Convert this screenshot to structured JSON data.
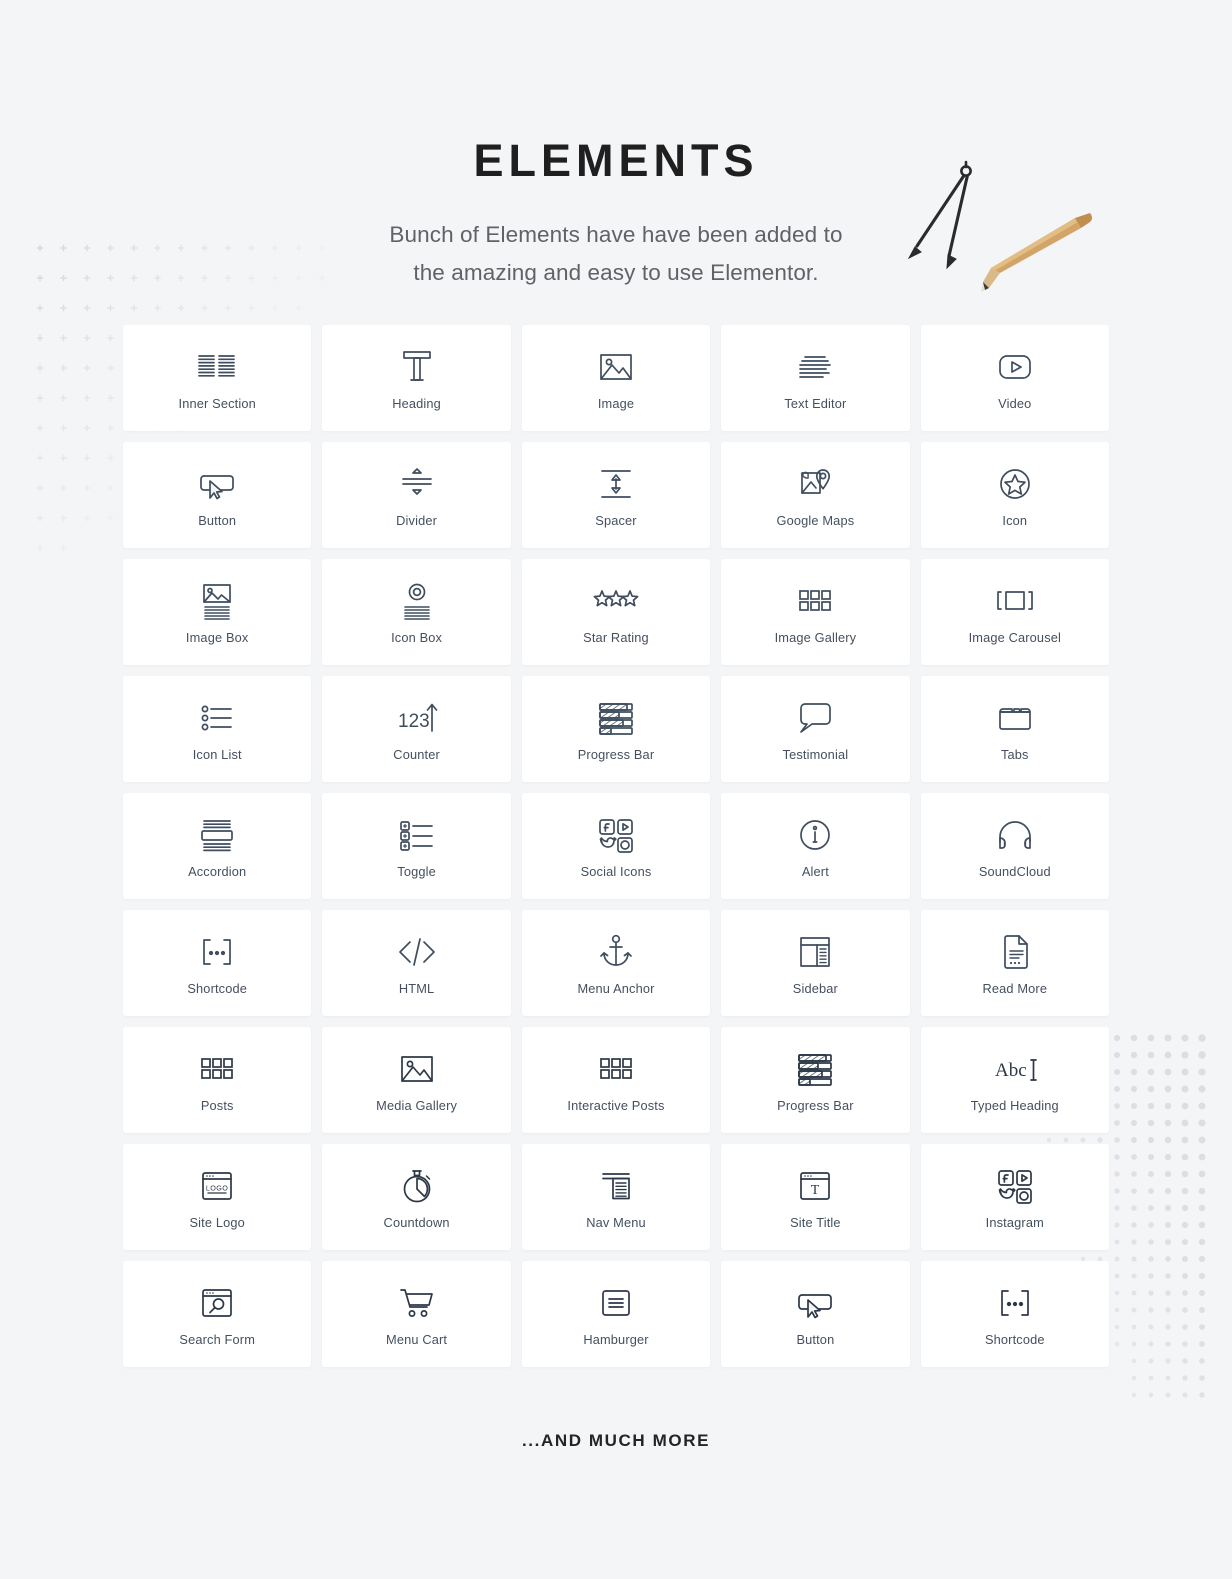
{
  "header": {
    "title": "ELEMENTS",
    "subtitle_line1": "Bunch of Elements have have been added to",
    "subtitle_line2": "the amazing and easy to use  Elementor."
  },
  "footer": {
    "text": "...AND MUCH MORE"
  },
  "colors": {
    "page_background": "#f4f5f7",
    "card_background": "#ffffff",
    "icon_stroke": "#3f4d5e",
    "label_text": "#44505f",
    "title_text": "#1f1f1f",
    "subtitle_text": "#5f6368",
    "decoration": "#d8d9dc",
    "pencil_wood": "#d8b07a",
    "pencil_body": "#c79a5e"
  },
  "grid": {
    "columns": 5,
    "cards": [
      {
        "label": "Inner Section",
        "icon": "inner-section-icon"
      },
      {
        "label": "Heading",
        "icon": "heading-t-icon"
      },
      {
        "label": "Image",
        "icon": "image-icon"
      },
      {
        "label": "Text Editor",
        "icon": "text-editor-icon"
      },
      {
        "label": "Video",
        "icon": "video-play-icon"
      },
      {
        "label": "Button",
        "icon": "button-cursor-icon"
      },
      {
        "label": "Divider",
        "icon": "divider-icon"
      },
      {
        "label": "Spacer",
        "icon": "spacer-icon"
      },
      {
        "label": "Google Maps",
        "icon": "google-maps-pin-icon"
      },
      {
        "label": "Icon",
        "icon": "star-circle-icon"
      },
      {
        "label": "Image Box",
        "icon": "image-box-icon"
      },
      {
        "label": "Icon Box",
        "icon": "icon-box-icon"
      },
      {
        "label": "Star Rating",
        "icon": "star-rating-icon"
      },
      {
        "label": "Image Gallery",
        "icon": "grid-gallery-icon"
      },
      {
        "label": "Image Carousel",
        "icon": "carousel-icon"
      },
      {
        "label": "Icon List",
        "icon": "icon-list-icon"
      },
      {
        "label": "Counter",
        "icon": "counter-123-icon"
      },
      {
        "label": "Progress Bar",
        "icon": "progress-bar-icon"
      },
      {
        "label": "Testimonial",
        "icon": "speech-bubble-icon"
      },
      {
        "label": "Tabs",
        "icon": "tabs-folder-icon"
      },
      {
        "label": "Accordion",
        "icon": "accordion-icon"
      },
      {
        "label": "Toggle",
        "icon": "toggle-list-icon"
      },
      {
        "label": "Social Icons",
        "icon": "social-icons-icon"
      },
      {
        "label": "Alert",
        "icon": "info-circle-icon"
      },
      {
        "label": "SoundCloud",
        "icon": "headphones-icon"
      },
      {
        "label": "Shortcode",
        "icon": "shortcode-brackets-icon"
      },
      {
        "label": "HTML",
        "icon": "code-tags-icon"
      },
      {
        "label": "Menu Anchor",
        "icon": "anchor-icon"
      },
      {
        "label": "Sidebar",
        "icon": "sidebar-layout-icon"
      },
      {
        "label": "Read More",
        "icon": "document-page-icon"
      },
      {
        "label": "Posts",
        "icon": "grid-gallery-icon"
      },
      {
        "label": "Media Gallery",
        "icon": "image-icon"
      },
      {
        "label": "Interactive Posts",
        "icon": "grid-gallery-icon"
      },
      {
        "label": "Progress Bar",
        "icon": "progress-bar-icon"
      },
      {
        "label": "Typed Heading",
        "icon": "typed-abc-icon"
      },
      {
        "label": "Site Logo",
        "icon": "site-logo-icon"
      },
      {
        "label": "Countdown",
        "icon": "stopwatch-icon"
      },
      {
        "label": "Nav Menu",
        "icon": "nav-menu-icon"
      },
      {
        "label": "Site Title",
        "icon": "site-title-icon"
      },
      {
        "label": "Instagram",
        "icon": "social-icons-icon"
      },
      {
        "label": "Search Form",
        "icon": "search-form-icon"
      },
      {
        "label": "Menu Cart",
        "icon": "shopping-cart-icon"
      },
      {
        "label": "Hamburger",
        "icon": "hamburger-icon"
      },
      {
        "label": "Button",
        "icon": "button-cursor-icon"
      },
      {
        "label": "Shortcode",
        "icon": "shortcode-brackets-icon"
      }
    ]
  }
}
